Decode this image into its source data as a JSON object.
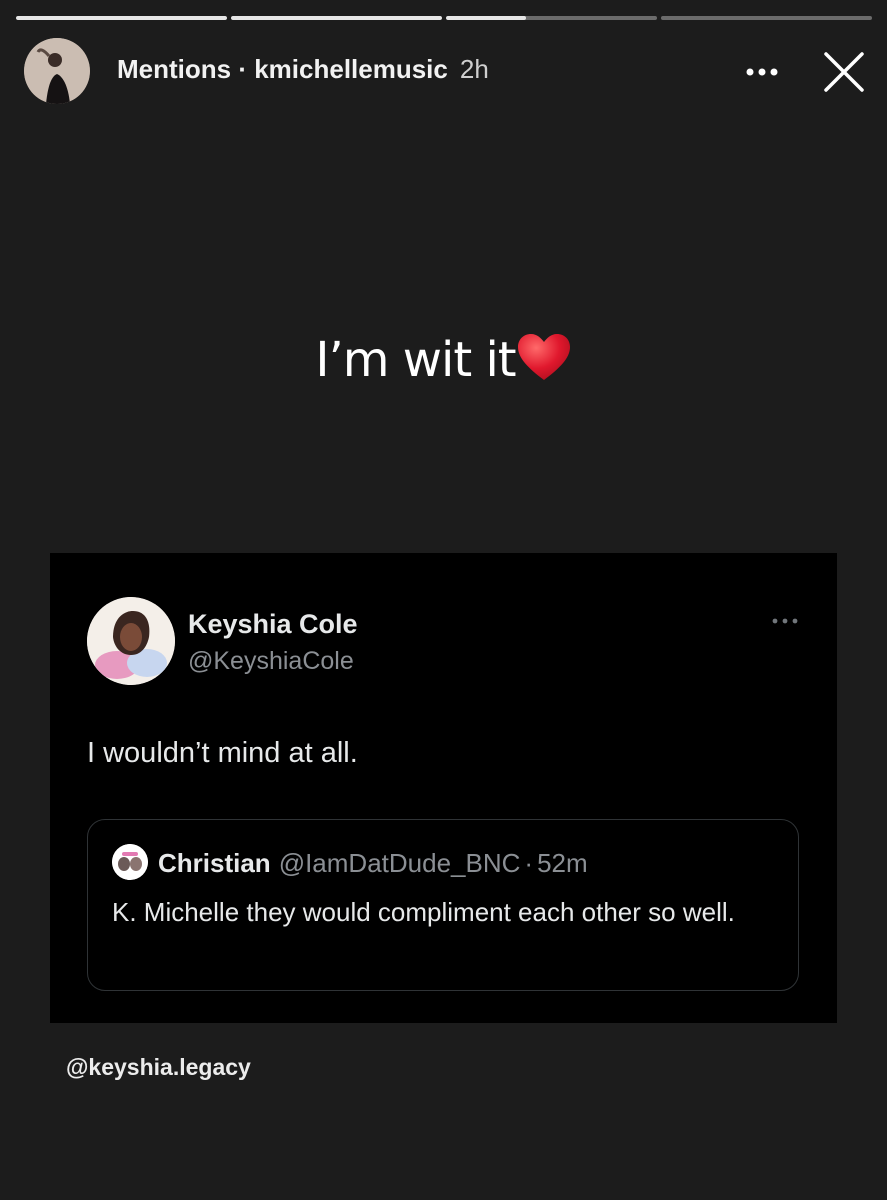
{
  "story": {
    "progress_segments": [
      1,
      1,
      0.38,
      0
    ],
    "header": {
      "title": "Mentions · kmichellemusic",
      "time": "2h",
      "more_icon": "more-horizontal-icon",
      "close_icon": "close-icon"
    },
    "caption": {
      "text": "I’m wit it",
      "emoji": "❤️"
    },
    "credit": "@keyshia.legacy"
  },
  "tweet": {
    "name": "Keyshia Cole",
    "handle": "@KeyshiaCole",
    "text": "I wouldn’t mind at all.",
    "more_icon": "more-horizontal-icon",
    "quote": {
      "name": "Christian",
      "handle": "@IamDatDude_BNC",
      "separator": "·",
      "time": "52m",
      "text": "K. Michelle they would compliment each other so well."
    }
  },
  "colors": {
    "background": "#1c1c1c",
    "tweet_background": "#000000",
    "muted_text": "#8b8f94",
    "heart": "#e0182d"
  }
}
